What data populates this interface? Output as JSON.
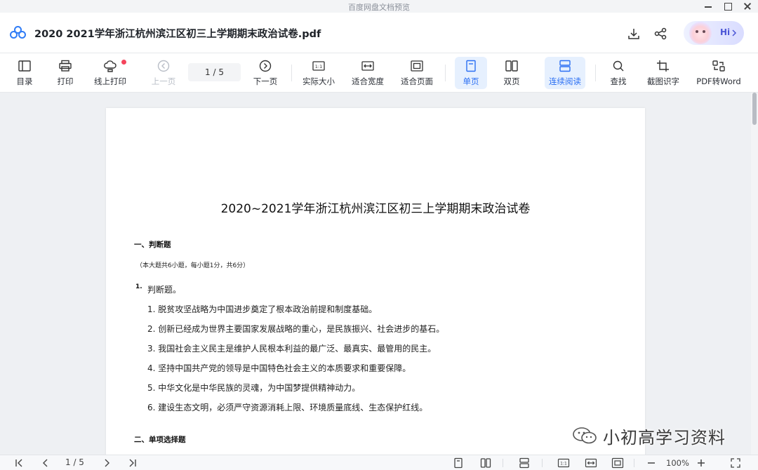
{
  "window": {
    "title": "百度网盘文档预览"
  },
  "header": {
    "doc_title": "2020  2021学年浙江杭州滨江区初三上学期期末政治试卷.pdf",
    "icons": [
      "download-icon",
      "share-icon"
    ],
    "assistant_label": "Hi"
  },
  "toolbar": {
    "items": [
      {
        "label": "目录",
        "icon": "toc-icon"
      },
      {
        "label": "打印",
        "icon": "print-icon"
      },
      {
        "label": "线上打印",
        "icon": "cloud-print-icon",
        "badge": true
      },
      {
        "label": "上一页",
        "icon": "prev-page-icon",
        "disabled": true
      },
      {
        "label": "下一页",
        "icon": "next-page-icon"
      },
      {
        "label": "实际大小",
        "icon": "actual-size-icon"
      },
      {
        "label": "适合宽度",
        "icon": "fit-width-icon"
      },
      {
        "label": "适合页面",
        "icon": "fit-page-icon"
      },
      {
        "label": "单页",
        "icon": "single-page-icon",
        "active": true
      },
      {
        "label": "双页",
        "icon": "double-page-icon"
      },
      {
        "label": "连续阅读",
        "icon": "continuous-icon",
        "active": true
      },
      {
        "label": "查找",
        "icon": "search-icon"
      },
      {
        "label": "截图识字",
        "icon": "screenshot-ocr-icon"
      },
      {
        "label": "PDF转Word",
        "icon": "pdf-to-word-icon"
      }
    ],
    "page_indicator": "1  /  5"
  },
  "document": {
    "title": "2020~2021学年浙江杭州滨江区初三上学期期末政治试卷",
    "section1": "一、判断题",
    "note": "（本大题共6小题，每小题1分，共6分）",
    "question_number": "1.",
    "question": "判断题。",
    "items": [
      "1. 脱贫攻坚战略为中国进步奠定了根本政治前提和制度基础。",
      "2. 创新已经成为世界主要国家发展战略的重心，是民族振兴、社会进步的基石。",
      "3. 我国社会主义民主是维护人民根本利益的最广泛、最真实、最管用的民主。",
      "4. 坚持中国共产党的领导是中国特色社会主义的本质要求和重要保障。",
      "5. 中华文化是中华民族的灵魂，为中国梦提供精神动力。",
      "6. 建设生态文明，必须严守资源消耗上限、环境质量底线、生态保护红线。"
    ],
    "section2": "二、单项选择题"
  },
  "watermark": {
    "text": "小初高学习资料"
  },
  "bottombar": {
    "page_indicator": "1 / 5",
    "zoom": "100%"
  },
  "colors": {
    "accent": "#2b6ff3",
    "active_bg": "#e6f0fe",
    "badge": "#f5455c"
  }
}
